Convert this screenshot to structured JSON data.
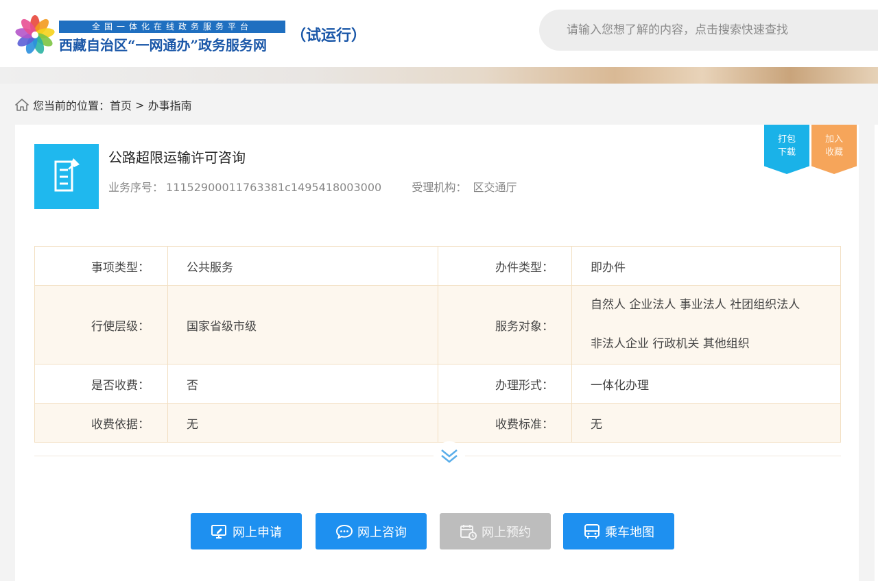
{
  "header": {
    "logo_top": "全国一体化在线政务服务平台",
    "logo_main": "西藏自治区“一网通办”政务服务网",
    "logo_trial": "（试运行）",
    "search_placeholder": "请输入您想了解的内容，点击搜索快速查找"
  },
  "breadcrumb": {
    "prefix": "您当前的位置：",
    "home": "首页",
    "separator": " > ",
    "current": "办事指南"
  },
  "service": {
    "title": "公路超限运输许可咨询",
    "id_label": "业务序号：",
    "id_value": "11152900011763381c1495418003000",
    "org_label": "受理机构：",
    "org_value": "区交通厅"
  },
  "ribbons": {
    "download": [
      "打包",
      "下载"
    ],
    "favorite": [
      "加入",
      "收藏"
    ]
  },
  "info": {
    "rows": [
      {
        "k1": "事项类型：",
        "v1": "公共服务",
        "k2": "办件类型：",
        "v2": "即办件"
      },
      {
        "k1": "行使层级：",
        "v1": "国家省级市级",
        "k2": "服务对象：",
        "v2_lines": [
          "自然人 企业法人 事业法人 社团组织法人",
          "非法人企业 行政机关 其他组织"
        ]
      },
      {
        "k1": "是否收费：",
        "v1": "否",
        "k2": "办理形式：",
        "v2": "一体化办理"
      },
      {
        "k1": "收费依据：",
        "v1": "无",
        "k2": "收费标准：",
        "v2": "无"
      }
    ]
  },
  "actions": {
    "apply": "网上申请",
    "consult": "网上咨询",
    "reserve": "网上预约",
    "map": "乘车地图"
  },
  "colors": {
    "accent": "#1e90f0",
    "doc_icon_bg": "#1fb8ee",
    "ribbon_download": "#1ab2e8",
    "ribbon_favorite": "#f6a55a",
    "disabled": "#bdbdbd",
    "table_border": "#f2dfc2"
  }
}
